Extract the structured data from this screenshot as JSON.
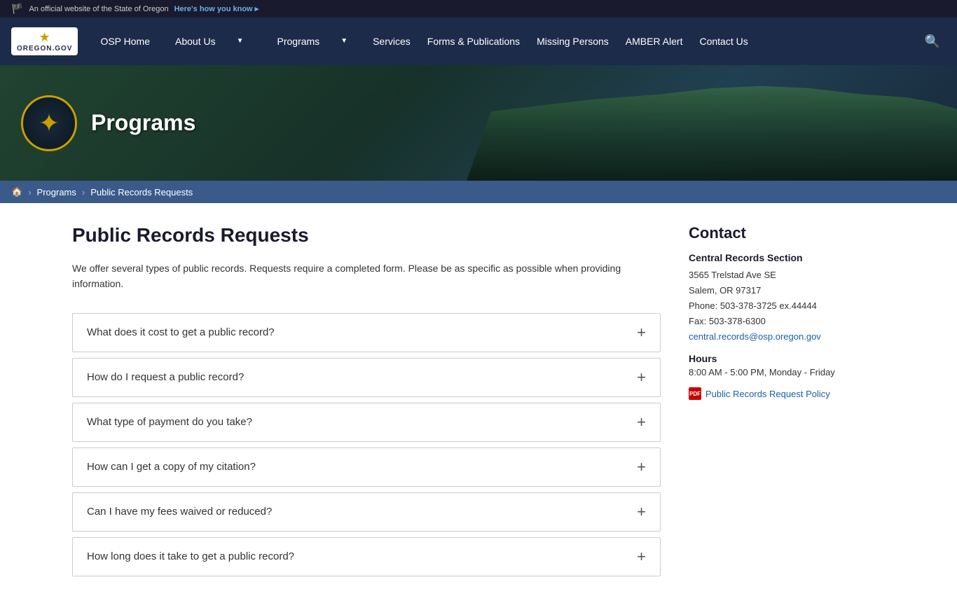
{
  "topbar": {
    "official_text": "An official website of the State of Oregon",
    "link_text": "Here's how you know ▸",
    "flag_emoji": "🏳"
  },
  "nav": {
    "logo_text": "OREGON.GOV",
    "items": [
      {
        "id": "osp-home",
        "label": "OSP Home",
        "has_dropdown": false
      },
      {
        "id": "about-us",
        "label": "About Us",
        "has_dropdown": true
      },
      {
        "id": "programs",
        "label": "Programs",
        "has_dropdown": true
      },
      {
        "id": "services",
        "label": "Services",
        "has_dropdown": false
      },
      {
        "id": "forms-publications",
        "label": "Forms & Publications",
        "has_dropdown": false
      },
      {
        "id": "missing-persons",
        "label": "Missing Persons",
        "has_dropdown": false
      },
      {
        "id": "amber-alert",
        "label": "AMBER Alert",
        "has_dropdown": false
      },
      {
        "id": "contact-us",
        "label": "Contact Us",
        "has_dropdown": false
      }
    ]
  },
  "hero": {
    "title": "Programs"
  },
  "breadcrumb": {
    "home_label": "🏠",
    "items": [
      {
        "label": "Programs",
        "href": "#"
      },
      {
        "label": "Public Records Requests",
        "href": "#"
      }
    ],
    "separator": "›"
  },
  "main": {
    "page_title": "Public Records Requests",
    "intro_text": "We offer several types of public records.  Requests require a completed form. Please be as specific as possible when providing information.",
    "accordion_items": [
      {
        "id": "cost",
        "question": "What does it cost to get a public record?"
      },
      {
        "id": "how-request",
        "question": "How do I request a public record?"
      },
      {
        "id": "payment",
        "question": "What type of payment do you take?"
      },
      {
        "id": "citation",
        "question": "How can I get a copy of my citation?"
      },
      {
        "id": "waived",
        "question": "Can I have my fees waived or reduced?"
      },
      {
        "id": "how-long",
        "question": "How long does it take to get a public record?"
      }
    ]
  },
  "sidebar": {
    "contact_title": "Contact",
    "section_name": "Central Records Section",
    "address_line1": "3565 Trelstad Ave SE",
    "address_line2": "Salem, OR 97317",
    "phone": "Phone: 503-378-3725 ex.44444",
    "fax": "Fax: 503-378-6300",
    "email": "central.records@osp.oregon.gov",
    "hours_title": "Hours",
    "hours_text": "8:00 AM - 5:00 PM, Monday - Friday",
    "pdf_link_text": "Public Records Request Policy"
  }
}
